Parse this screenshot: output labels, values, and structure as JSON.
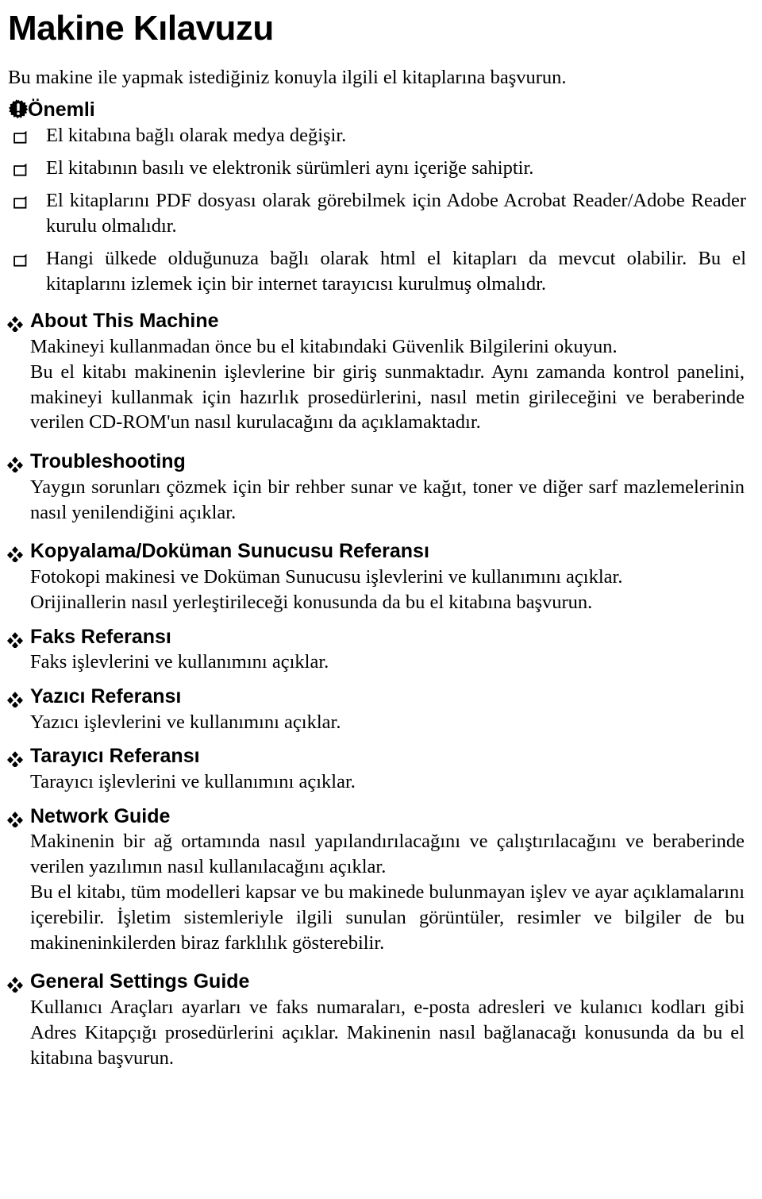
{
  "document": {
    "title": "Makine Kılavuzu",
    "intro": "Bu makine ile yapmak istediğiniz konuyla ilgili el kitaplarına başvurun.",
    "important": {
      "icon": "important-burst-icon",
      "label": "Önemli",
      "items": [
        "El kitabına bağlı olarak medya değişir.",
        "El kitabının basılı ve elektronik sürümleri aynı içeriğe sahiptir.",
        "El kitaplarını PDF dosyası olarak görebilmek için Adobe Acrobat Reader/Adobe Reader kurulu olmalıdır.",
        "Hangi ülkede olduğunuza bağlı olarak html el kitapları da mevcut olabilir. Bu el kitaplarını izlemek için bir internet tarayıcısı kurulmuş olmalıdr."
      ]
    },
    "sections": [
      {
        "title": "About This Machine",
        "paragraphs": [
          "Makineyi kullanmadan önce bu el kitabındaki Güvenlik Bilgilerini okuyun.",
          "Bu el kitabı makinenin işlevlerine bir giriş sunmaktadır. Aynı zamanda kontrol panelini, makineyi kullanmak için hazırlık prosedürlerini, nasıl metin girileceğini ve beraberinde verilen CD-ROM'un nasıl kurulacağını da açıklamaktadır."
        ]
      },
      {
        "title": "Troubleshooting",
        "paragraphs": [
          "Yaygın sorunları çözmek için bir rehber sunar ve kağıt, toner ve diğer sarf mazlemelerinin nasıl yenilendiğini açıklar."
        ]
      },
      {
        "title": "Kopyalama/Doküman Sunucusu Referansı",
        "paragraphs": [
          "Fotokopi makinesi ve Doküman Sunucusu işlevlerini ve kullanımını açıklar.",
          "Orijinallerin nasıl yerleştirileceği konusunda da bu el kitabına başvurun."
        ]
      },
      {
        "title": "Faks Referansı",
        "paragraphs": [
          "Faks işlevlerini ve kullanımını açıklar."
        ]
      },
      {
        "title": "Yazıcı Referansı",
        "paragraphs": [
          "Yazıcı işlevlerini ve kullanımını açıklar."
        ]
      },
      {
        "title": "Tarayıcı Referansı",
        "paragraphs": [
          "Tarayıcı işlevlerini ve kullanımını açıklar."
        ]
      },
      {
        "title": "Network Guide",
        "paragraphs": [
          "Makinenin bir ağ ortamında nasıl yapılandırılacağını ve çalıştırılacağını ve beraberinde verilen yazılımın nasıl kullanılacağını açıklar.",
          "Bu el kitabı, tüm modelleri kapsar ve bu makinede bulunmayan işlev ve ayar açıklamalarını içerebilir. İşletim sistemleriyle ilgili sunulan görüntüler, resimler ve bilgiler de bu makineninkilerden biraz farklılık gösterebilir."
        ]
      },
      {
        "title": "General Settings Guide",
        "paragraphs": [
          "Kullanıcı Araçları ayarları ve faks numaraları, e-posta adresleri ve kulanıcı kodları gibi Adres Kitapçığı prosedürlerini açıklar. Makinenin nasıl bağlanacağı konusunda da bu el kitabına başvurun."
        ]
      }
    ],
    "icons": {
      "section_bullet": "diamond-cluster-icon",
      "list_bullet": "notched-square-icon"
    },
    "colors": {
      "text": "#000000",
      "background": "#ffffff"
    }
  }
}
